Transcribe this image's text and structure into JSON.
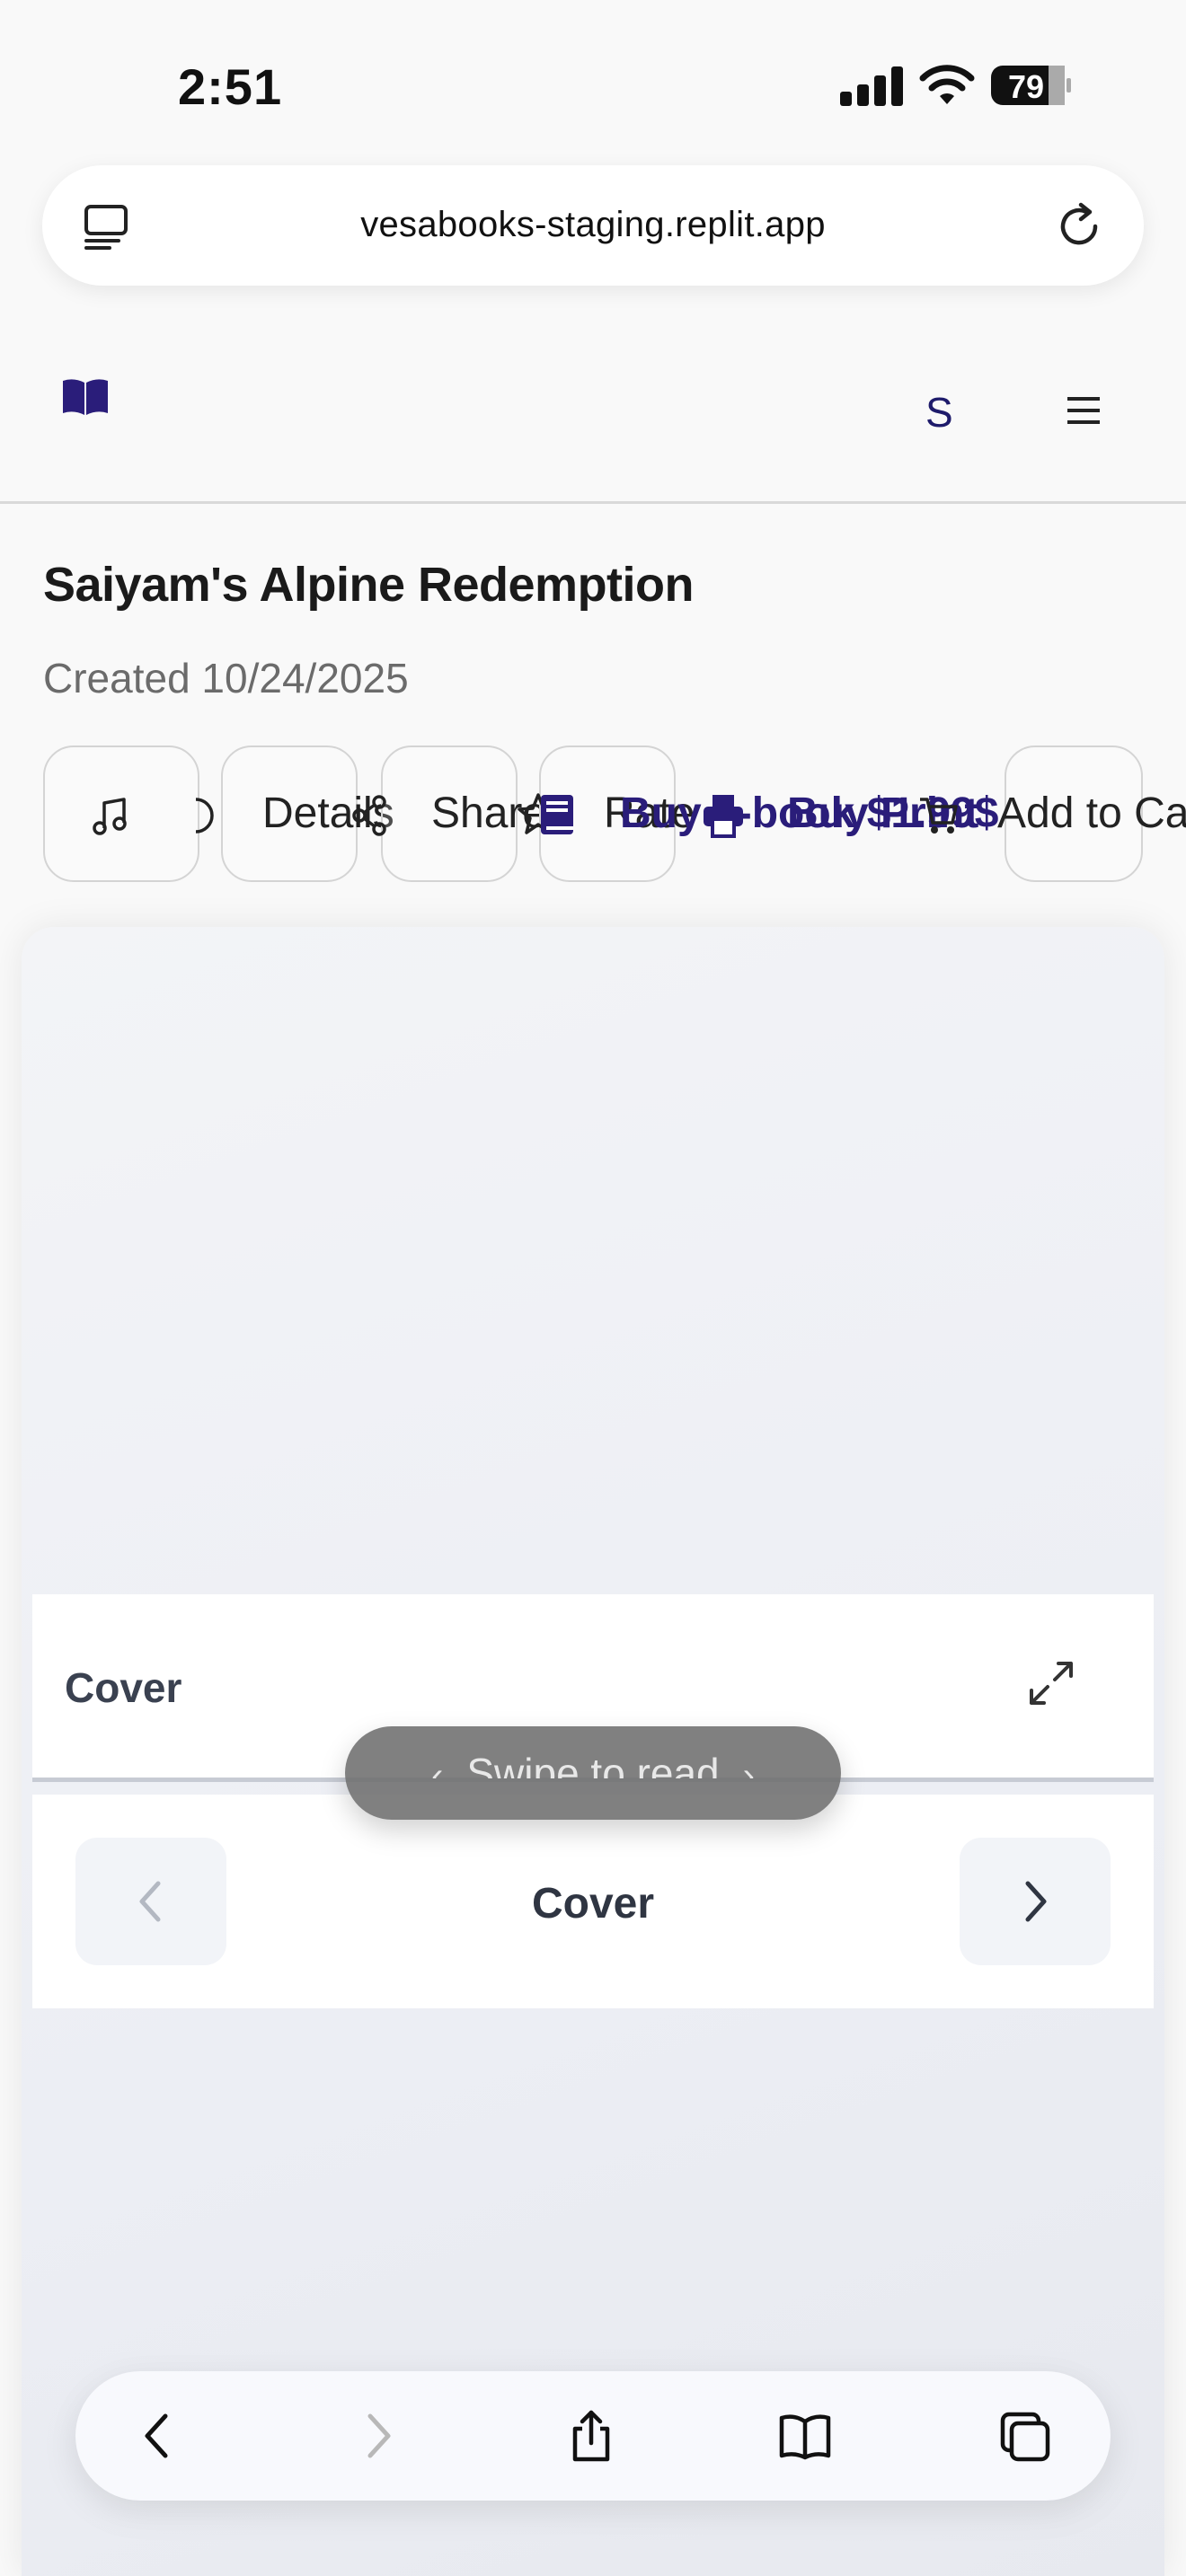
{
  "status_bar": {
    "time": "2:51",
    "battery": "79",
    "signal_icon": "cellular-signal-icon",
    "wifi_icon": "wifi-icon",
    "battery_icon": "battery-icon"
  },
  "browser": {
    "url": "vesabooks-staging.replit.app",
    "tabs_icon": "tab-overview-icon",
    "reload_icon": "reload-icon"
  },
  "site_header": {
    "logo_icon": "open-book-icon",
    "avatar_letter": "S",
    "menu_icon": "hamburger-menu-icon"
  },
  "book": {
    "title": "Saiyam's Alpine Redemption",
    "created": "Created 10/24/2025"
  },
  "actions": {
    "music_icon": "music-note-icon",
    "details_label": "Details",
    "share_label": "Share",
    "rate_label": "Rate",
    "buy_ebook_label": "Buy e-book $1.99$",
    "buy_print_label": "Buy Print",
    "add_to_cart_label": "Add to Cart"
  },
  "reader": {
    "panel_title": "Cover",
    "swipe_hint": "Swipe to read",
    "nav_label": "Cover",
    "expand_icon": "expand-arrows-icon",
    "prev_icon": "chevron-left-icon",
    "next_icon": "chevron-right-icon"
  },
  "toolbar": {
    "back_icon": "back-arrow-icon",
    "forward_icon": "forward-arrow-icon",
    "share_icon": "share-icon",
    "bookmarks_icon": "bookmarks-icon",
    "tabs_icon": "tabs-icon"
  },
  "colors": {
    "accent": "#2a1d7a",
    "background": "#f9f9f9",
    "reader_bg": "#eceef4"
  }
}
